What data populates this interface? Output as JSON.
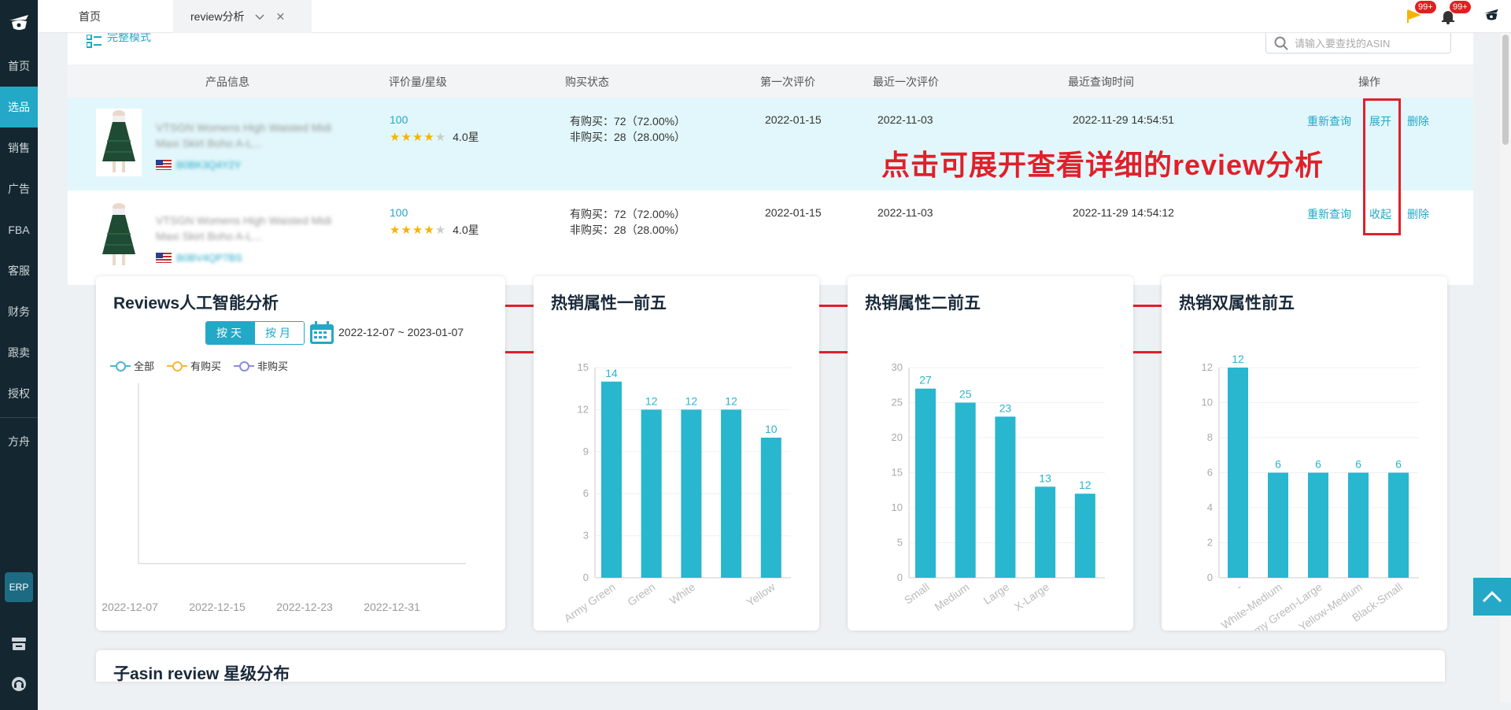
{
  "sidebar": {
    "items": [
      {
        "label": "首页"
      },
      {
        "label": "选品",
        "active": true
      },
      {
        "label": "销售"
      },
      {
        "label": "广告"
      },
      {
        "label": "FBA"
      },
      {
        "label": "客服"
      },
      {
        "label": "财务"
      },
      {
        "label": "跟卖"
      },
      {
        "label": "授权"
      },
      {
        "label": "方舟"
      }
    ],
    "erp_label": "ERP"
  },
  "tabs": {
    "home": "首页",
    "review": "review分析"
  },
  "header": {
    "notice_badge": "99+",
    "bell_badge": "99+"
  },
  "toolbar": {
    "mode_label": "完整模式",
    "search_placeholder": "请输入要查找的ASIN"
  },
  "table": {
    "columns": [
      "产品信息",
      "评价量/星级",
      "购买状态",
      "第一次评价",
      "最近一次评价",
      "最近查询时间",
      "操作"
    ],
    "rows": [
      {
        "title": "VTSGN Womens High Waisted Midi Maxi Skirt Boho A-L...",
        "asin": "B0BK3Q4Y2Y",
        "count": "100",
        "stars": 4,
        "rating": "4.0星",
        "verified": "有购买：72（72.00%）",
        "unverified": "非购买：28（28.00%）",
        "first": "2022-01-15",
        "last": "2022-11-03",
        "queried": "2022-11-29 14:54:51",
        "action_requery": "重新查询",
        "action_toggle": "展开",
        "action_delete": "删除"
      },
      {
        "title": "VTSGN Womens High Waisted Midi Maxi Skirt Boho A-L...",
        "asin": "B0BV4QP7BS",
        "count": "100",
        "stars": 4,
        "rating": "4.0星",
        "verified": "有购买：72（72.00%）",
        "unverified": "非购买：28（28.00%）",
        "first": "2022-01-15",
        "last": "2022-11-03",
        "queried": "2022-11-29 14:54:12",
        "action_requery": "重新查询",
        "action_toggle": "收起",
        "action_delete": "删除"
      }
    ]
  },
  "annotation": "点击可展开查看详细的review分析",
  "ai_card": {
    "title": "Reviews人工智能分析",
    "by_day": "按天",
    "by_month": "按月",
    "date_range": "2022-12-07 ~ 2023-01-07",
    "legend": [
      {
        "label": "全部",
        "color": "#4fb3d6"
      },
      {
        "label": "有购买",
        "color": "#f5b83a"
      },
      {
        "label": "非购买",
        "color": "#8b8fd8"
      }
    ]
  },
  "bottom": {
    "title": "子asin review 星级分布"
  },
  "chart_data": [
    {
      "type": "line",
      "title": "Reviews人工智能分析",
      "x": [
        "2022-12-07",
        "2022-12-15",
        "2022-12-23",
        "2022-12-31"
      ],
      "series": [
        {
          "name": "全部",
          "values": []
        },
        {
          "name": "有购买",
          "values": []
        },
        {
          "name": "非购买",
          "values": []
        }
      ],
      "legend": "top-left"
    },
    {
      "type": "bar",
      "title": "热销属性一前五",
      "categories": [
        "Army Green",
        "Green",
        "White",
        "",
        "Yellow"
      ],
      "values": [
        14,
        12,
        12,
        12,
        10
      ],
      "yticks": [
        0,
        3,
        6,
        9,
        12,
        15
      ],
      "ylim": [
        0,
        15
      ],
      "color": "#29b6cf"
    },
    {
      "type": "bar",
      "title": "热销属性二前五",
      "categories": [
        "Small",
        "Medium",
        "Large",
        "X-Large",
        ""
      ],
      "values": [
        27,
        25,
        23,
        13,
        12
      ],
      "yticks": [
        0,
        5,
        10,
        15,
        20,
        25,
        30
      ],
      "ylim": [
        0,
        30
      ],
      "color": "#29b6cf"
    },
    {
      "type": "bar",
      "title": "热销双属性前五",
      "categories": [
        "-",
        "White-Medium",
        "Army Green-Large",
        "Yellow-Medium",
        "Black-Small"
      ],
      "values": [
        12,
        6,
        6,
        6,
        6
      ],
      "yticks": [
        0,
        2,
        4,
        6,
        8,
        10,
        12
      ],
      "ylim": [
        0,
        12
      ],
      "color": "#29b6cf"
    }
  ]
}
